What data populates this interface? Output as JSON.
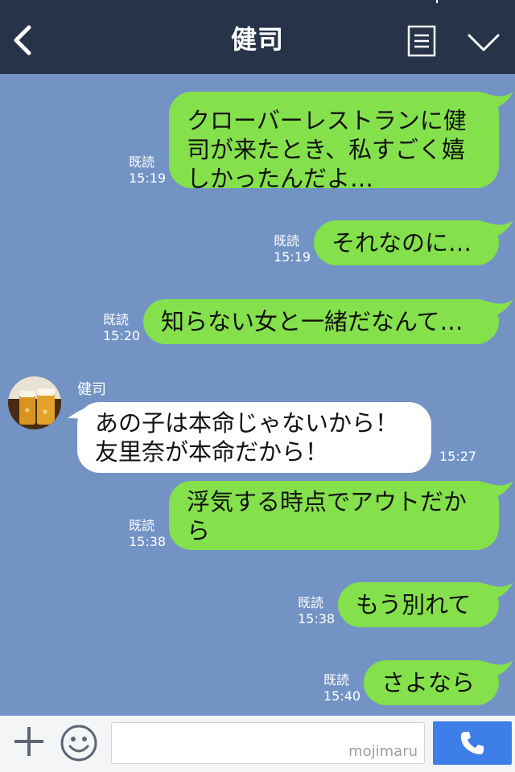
{
  "header": {
    "title": "健司"
  },
  "messages": [
    {
      "text_lines": [
        "クローバーレストランに健",
        "司が来たとき、私すごく嬉",
        "しかったんだよ…"
      ],
      "read": "既読",
      "time": "15:19"
    },
    {
      "text_lines": [
        "それなのに…"
      ],
      "read": "既読",
      "time": "15:19"
    },
    {
      "text_lines": [
        "知らない女と一緒だなんて…"
      ],
      "read": "既読",
      "time": "15:20"
    },
    {
      "sender": "健司",
      "text_lines": [
        "あの子は本命じゃないから！",
        "友里奈が本命だから！"
      ],
      "time": "15:27"
    },
    {
      "text_lines": [
        "浮気する時点でアウトだか",
        "ら"
      ],
      "read": "既読",
      "time": "15:38"
    },
    {
      "text_lines": [
        "もう別れて"
      ],
      "read": "既読",
      "time": "15:38"
    },
    {
      "text_lines": [
        "さよなら"
      ],
      "read": "既読",
      "time": "15:40"
    }
  ],
  "footer": {
    "watermark": "mojimaru"
  },
  "icons": [
    "back-icon",
    "menu-icon",
    "chevron-down-icon",
    "plus-icon",
    "emoji-icon",
    "phone-icon"
  ],
  "colors": {
    "background": "#7293c4",
    "header": "#263348",
    "sent_bubble": "#84e04b",
    "recv_bubble": "#ffffff",
    "call_button": "#3e7ee8"
  }
}
